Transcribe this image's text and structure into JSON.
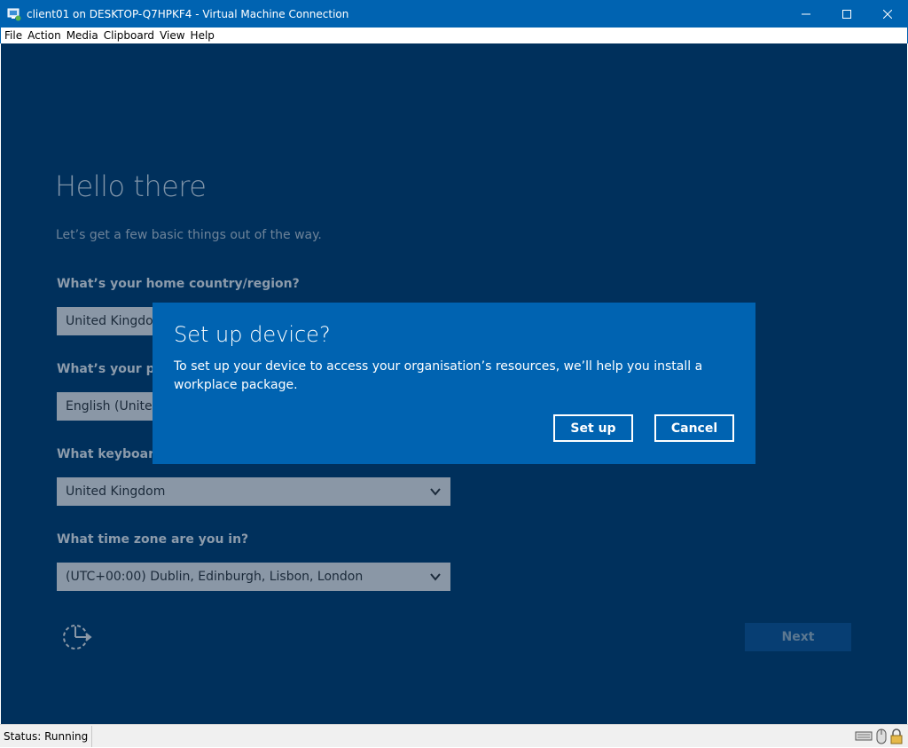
{
  "window": {
    "title": "client01 on DESKTOP-Q7HPKF4 - Virtual Machine Connection",
    "controls": [
      "minimize",
      "maximize",
      "close"
    ]
  },
  "menu": [
    "File",
    "Action",
    "Media",
    "Clipboard",
    "View",
    "Help"
  ],
  "oobe": {
    "title": "Hello there",
    "subtitle": "Let’s get a few basic things out of the way.",
    "questions": [
      {
        "label": "What’s your home country/region?",
        "value": "United Kingdom"
      },
      {
        "label": "What’s your preferred app language?",
        "value": "English (United Kingdom)"
      },
      {
        "label": "What keyboard layout would you like to use?",
        "value": "United Kingdom"
      },
      {
        "label": "What time zone are you in?",
        "value": "(UTC+00:00) Dublin, Edinburgh, Lisbon, London"
      }
    ],
    "next_label": "Next",
    "accessibility_icon": "ease-of-access-icon"
  },
  "dialog": {
    "title": "Set up device?",
    "body": "To set up your device to access your organisation’s resources, we’ll help you install a workplace package.",
    "setup_label": "Set up",
    "cancel_label": "Cancel"
  },
  "status": {
    "text": "Status: Running",
    "tray_icons": [
      "keyboard-icon",
      "mouse-icon",
      "lock-icon"
    ]
  },
  "colors": {
    "titlebar": "#0063b1",
    "vm_background": "#00305c",
    "dialog": "#0063b1"
  }
}
